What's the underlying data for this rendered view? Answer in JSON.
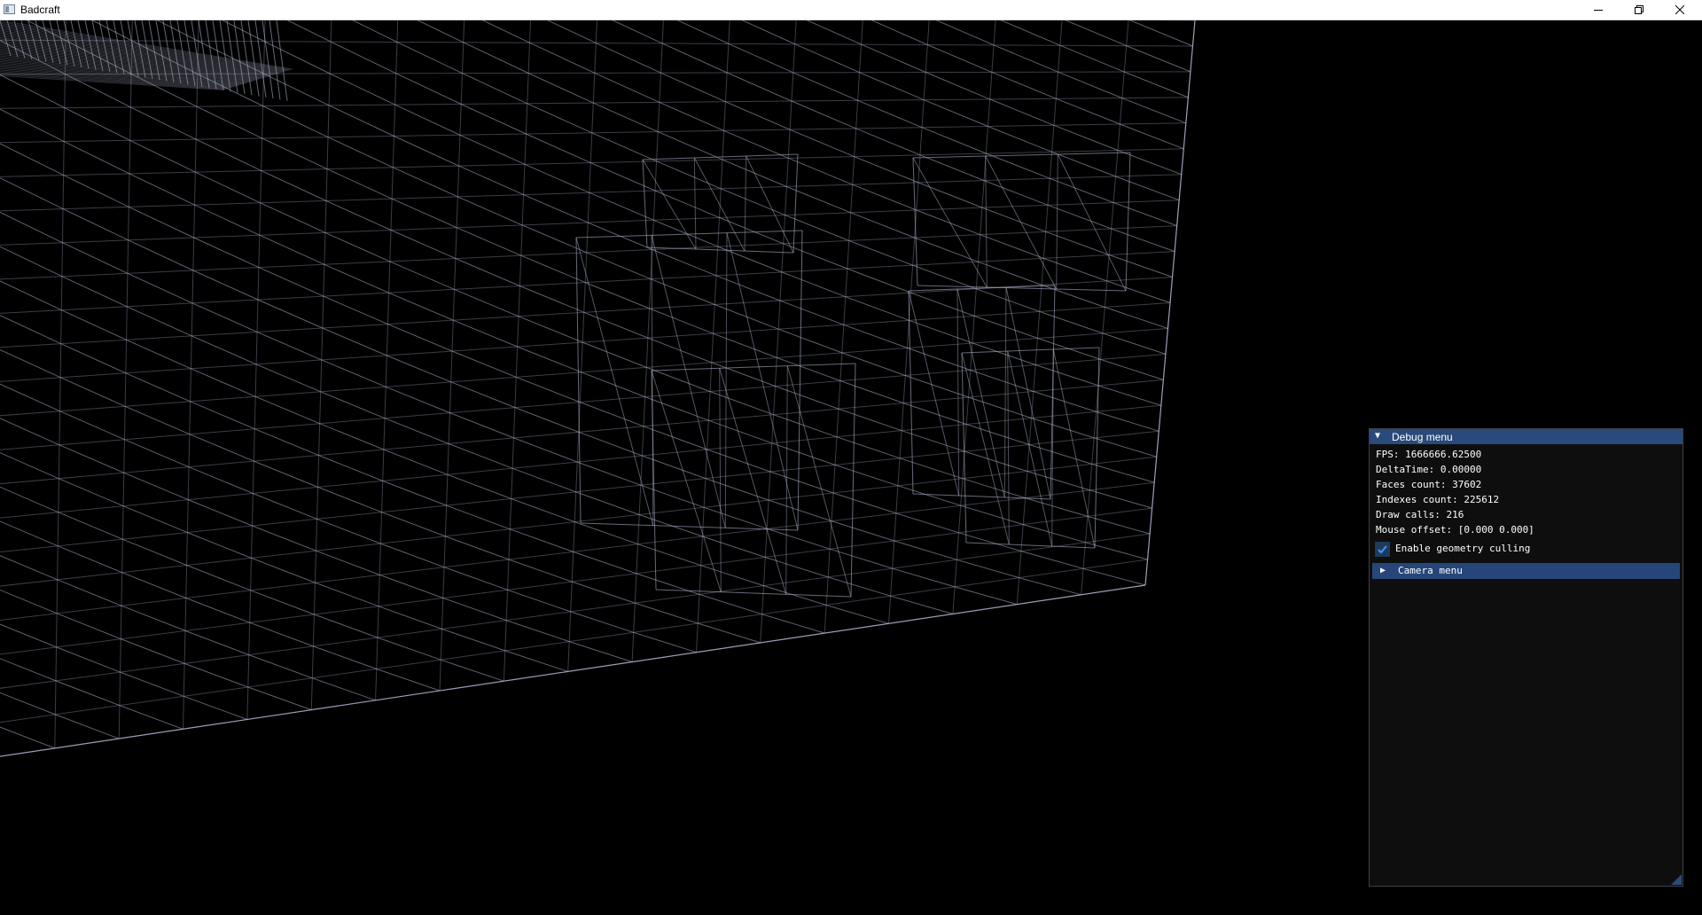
{
  "window": {
    "title": "Badcraft",
    "controls": {
      "minimize_icon": "minimize-icon",
      "maximize_icon": "restore-icon",
      "close_icon": "close-icon"
    }
  },
  "viewport": {
    "background": "#000000",
    "wireframe_color": "#aab0c8"
  },
  "debug_menu": {
    "title": "Debug menu",
    "header_color": "#294a7a",
    "expanded": true,
    "stats": {
      "fps": "FPS: 1666666.62500",
      "delta_time": "DeltaTime: 0.00000",
      "faces_count": "Faces count: 37602",
      "indexes_count": "Indexes count: 225612",
      "draw_calls": "Draw calls: 216",
      "mouse_offset": "Mouse offset: [0.000 0.000]"
    },
    "culling": {
      "label": "Enable geometry culling",
      "checked": true
    },
    "camera_menu": {
      "label": "Camera menu",
      "expanded": false
    }
  }
}
